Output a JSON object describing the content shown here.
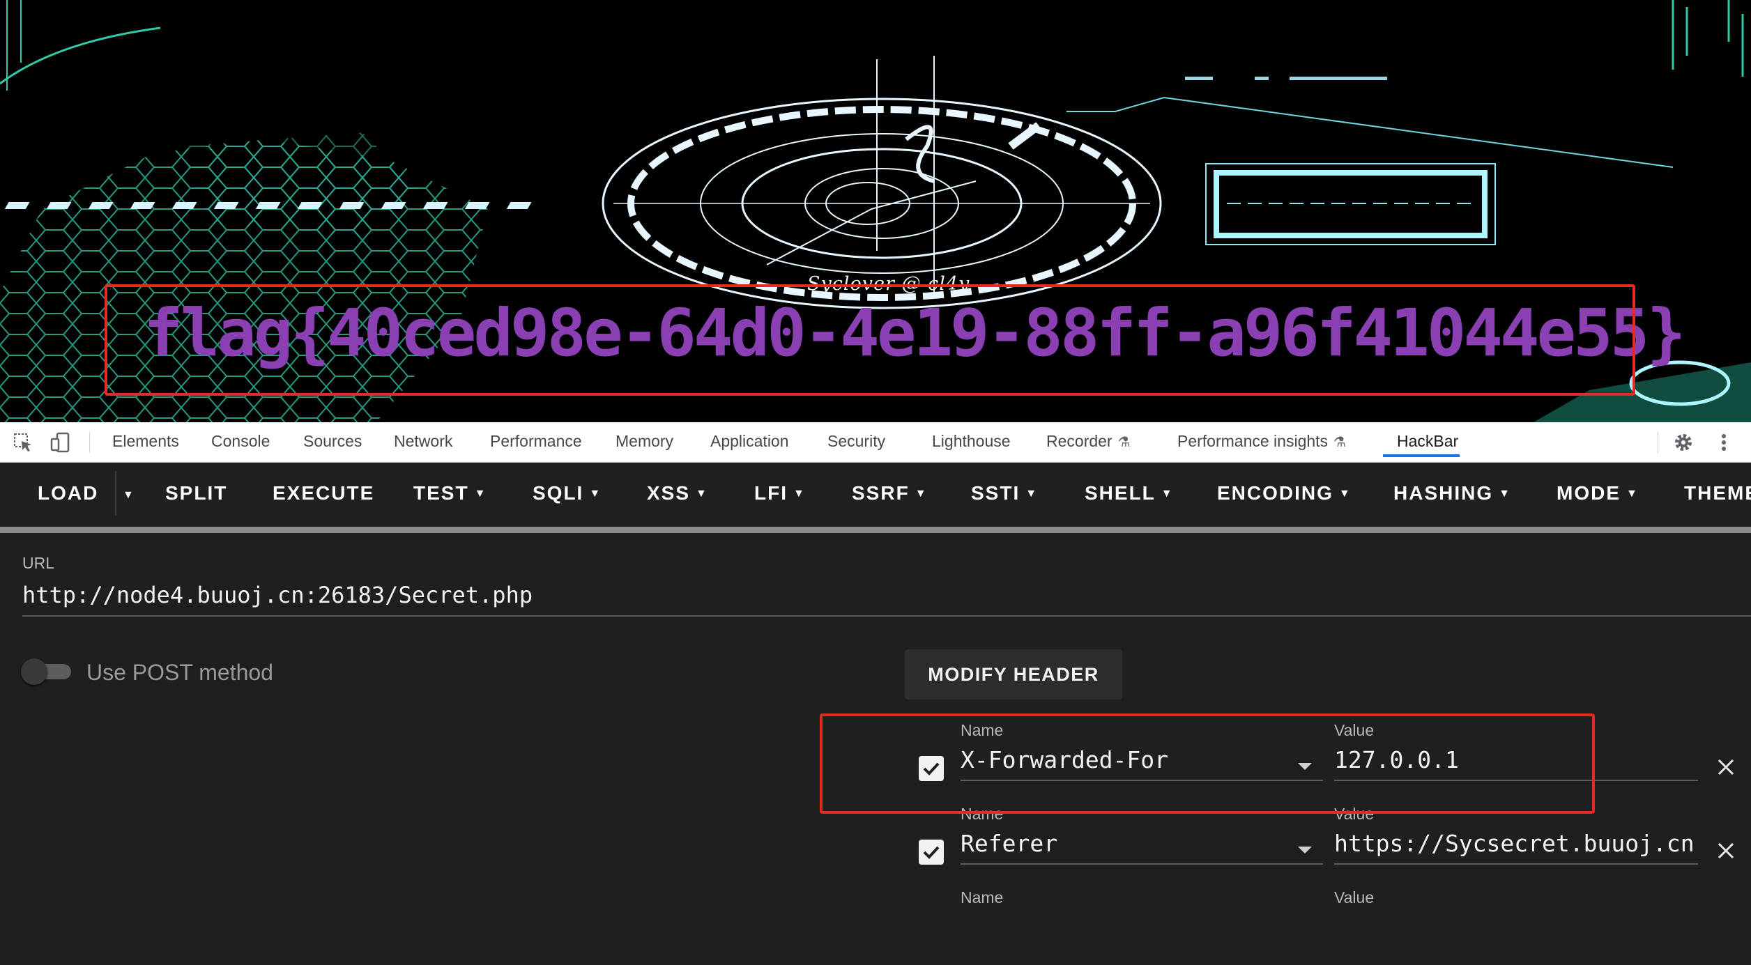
{
  "page": {
    "watermark": "Syclover @ cl4y",
    "flag": "flag{40ced98e-64d0-4e19-88ff-a96f41044e55}"
  },
  "devtools": {
    "tabs": [
      "Elements",
      "Console",
      "Sources",
      "Network",
      "Performance",
      "Memory",
      "Application",
      "Security",
      "Lighthouse",
      "Recorder",
      "Performance insights",
      "HackBar"
    ],
    "active_tab": "HackBar",
    "icons": [
      "inspect-element-icon",
      "device-toolbar-icon",
      "flask-icon",
      "settings-gear-icon",
      "more-vertical-icon"
    ]
  },
  "hackbar": {
    "toolbar": {
      "load": "LOAD",
      "split": "SPLIT",
      "execute": "EXECUTE",
      "test": "TEST",
      "sqli": "SQLI",
      "xss": "XSS",
      "lfi": "LFI",
      "ssrf": "SSRF",
      "ssti": "SSTI",
      "shell": "SHELL",
      "encoding": "ENCODING",
      "hashing": "HASHING",
      "mode": "MODE",
      "theme": "THEME"
    },
    "url": {
      "label": "URL",
      "value": "http://node4.buuoj.cn:26183/Secret.php"
    },
    "post": {
      "label": "Use POST method",
      "enabled": false
    },
    "modify_header_label": "MODIFY HEADER",
    "headers": [
      {
        "name_label": "Name",
        "value_label": "Value",
        "name": "X-Forwarded-For",
        "value": "127.0.0.1",
        "checked": true
      },
      {
        "name_label": "Name",
        "value_label": "Value",
        "name": "Referer",
        "value": "https://Sycsecret.buuoj.cn",
        "checked": true
      },
      {
        "name_label": "Name",
        "value_label": "Value",
        "name": "",
        "value": "",
        "checked": false
      }
    ]
  },
  "colors": {
    "flag_text": "#8a3fb3",
    "highlight_box": "#e42a21",
    "devtools_active_tab": "#1a73e8",
    "hackbar_bg": "#1f1f1f"
  }
}
